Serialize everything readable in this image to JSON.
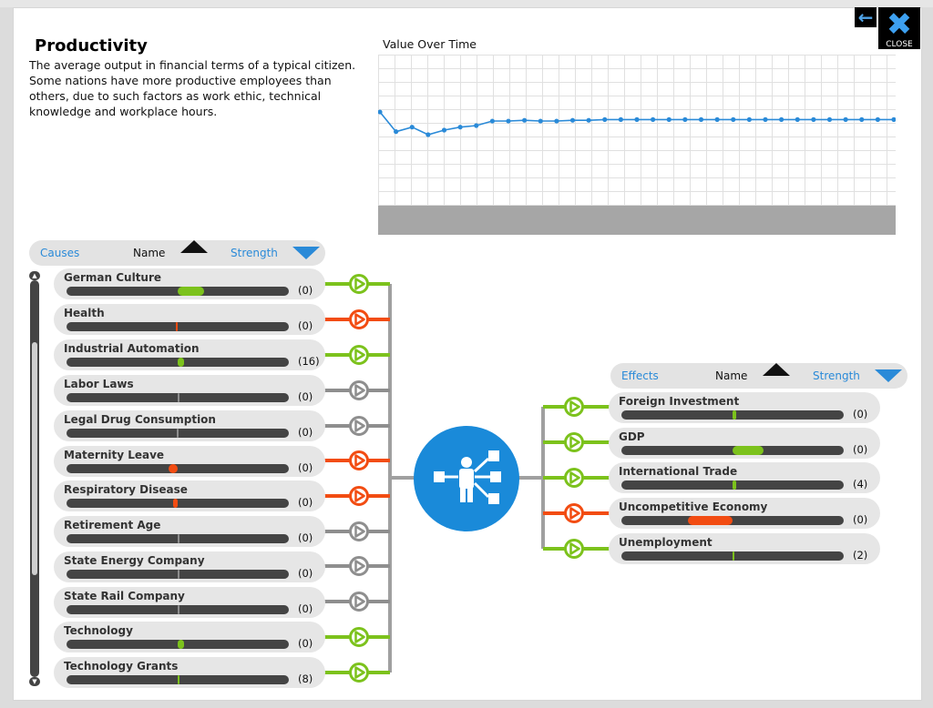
{
  "header": {
    "back_icon": "arrow-left-icon",
    "close_label": "CLOSE"
  },
  "policy": {
    "title": "Productivity",
    "description": "The average output in financial terms of a typical citizen. Some nations have more productive employees than others, due to such factors as work ethic, technical knowledge and workplace hours."
  },
  "chart_data": {
    "type": "line",
    "title": "Value Over Time",
    "xlabel": "",
    "ylabel": "",
    "grid": true,
    "ylim": [
      0,
      1
    ],
    "x": [
      1,
      2,
      3,
      4,
      5,
      6,
      7,
      8,
      9,
      10,
      11,
      12,
      13,
      14,
      15,
      16,
      17,
      18,
      19,
      20,
      21,
      22,
      23,
      24,
      25,
      26,
      27,
      28,
      29,
      30,
      31,
      32,
      33
    ],
    "values": [
      0.62,
      0.49,
      0.52,
      0.47,
      0.5,
      0.52,
      0.53,
      0.56,
      0.56,
      0.565,
      0.56,
      0.56,
      0.565,
      0.565,
      0.57,
      0.57,
      0.57,
      0.57,
      0.57,
      0.57,
      0.57,
      0.57,
      0.57,
      0.57,
      0.57,
      0.57,
      0.57,
      0.57,
      0.57,
      0.57,
      0.57,
      0.57,
      0.57
    ],
    "colors": {
      "line": "#2a8ad8",
      "grid": "#e0e0e0",
      "footer": "#a6a6a6"
    }
  },
  "causes": {
    "header": {
      "label": "Causes",
      "name_label": "Name",
      "strength_label": "Strength"
    },
    "items": [
      {
        "name": "German Culture",
        "value": "(0)",
        "effect": "positive",
        "bar": {
          "from": 0.5,
          "to": 0.62
        }
      },
      {
        "name": "Health",
        "value": "(0)",
        "effect": "negative",
        "bar": {
          "from": 0.49,
          "to": 0.5
        }
      },
      {
        "name": "Industrial Automation",
        "value": "(16)",
        "effect": "positive",
        "bar": {
          "from": 0.5,
          "to": 0.53
        }
      },
      {
        "name": "Labor Laws",
        "value": "(0)",
        "effect": "neutral",
        "bar": {
          "from": 0.5,
          "to": 0.505
        }
      },
      {
        "name": "Legal Drug Consumption",
        "value": "(0)",
        "effect": "neutral",
        "bar": {
          "from": 0.497,
          "to": 0.5
        }
      },
      {
        "name": "Maternity Leave",
        "value": "(0)",
        "effect": "negative",
        "bar": {
          "from": 0.46,
          "to": 0.5
        }
      },
      {
        "name": "Respiratory Disease",
        "value": "(0)",
        "effect": "negative",
        "bar": {
          "from": 0.48,
          "to": 0.5
        }
      },
      {
        "name": "Retirement Age",
        "value": "(0)",
        "effect": "neutral",
        "bar": {
          "from": 0.5,
          "to": 0.5
        }
      },
      {
        "name": "State Energy Company",
        "value": "(0)",
        "effect": "neutral",
        "bar": {
          "from": 0.5,
          "to": 0.5
        }
      },
      {
        "name": "State Rail Company",
        "value": "(0)",
        "effect": "neutral",
        "bar": {
          "from": 0.5,
          "to": 0.505
        }
      },
      {
        "name": "Technology",
        "value": "(0)",
        "effect": "positive",
        "bar": {
          "from": 0.5,
          "to": 0.53
        }
      },
      {
        "name": "Technology Grants",
        "value": "(8)",
        "effect": "positive",
        "bar": {
          "from": 0.5,
          "to": 0.51
        }
      }
    ]
  },
  "effects": {
    "header": {
      "label": "Effects",
      "name_label": "Name",
      "strength_label": "Strength"
    },
    "items": [
      {
        "name": "Foreign Investment",
        "value": "(0)",
        "effect": "positive",
        "bar": {
          "from": 0.5,
          "to": 0.515
        }
      },
      {
        "name": "GDP",
        "value": "(0)",
        "effect": "positive",
        "bar": {
          "from": 0.5,
          "to": 0.64
        }
      },
      {
        "name": "International Trade",
        "value": "(4)",
        "effect": "positive",
        "bar": {
          "from": 0.5,
          "to": 0.515
        }
      },
      {
        "name": "Uncompetitive Economy",
        "value": "(0)",
        "effect": "negative",
        "bar": {
          "from": 0.3,
          "to": 0.5
        }
      },
      {
        "name": "Unemployment",
        "value": "(2)",
        "effect": "positive",
        "bar": {
          "from": 0.5,
          "to": 0.505
        }
      }
    ]
  },
  "hub": {
    "icon": "productivity-icon"
  },
  "colors": {
    "positive": "#7cc21c",
    "negative": "#f24c12",
    "neutral": "#8e8e8e",
    "accent": "#2a8ad8",
    "connector": "#a0a0a0"
  }
}
